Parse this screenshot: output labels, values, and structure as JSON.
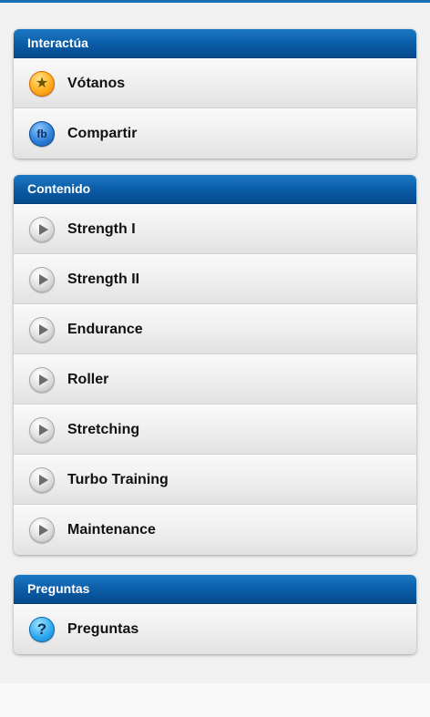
{
  "sections": [
    {
      "title": "Interactúa",
      "items": [
        {
          "label": "Vótanos",
          "icon": "star-icon"
        },
        {
          "label": "Compartir",
          "icon": "facebook-icon",
          "icon_text": "fb"
        }
      ]
    },
    {
      "title": "Contenido",
      "items": [
        {
          "label": "Strength I",
          "icon": "play-icon"
        },
        {
          "label": "Strength II",
          "icon": "play-icon"
        },
        {
          "label": "Endurance",
          "icon": "play-icon"
        },
        {
          "label": "Roller",
          "icon": "play-icon"
        },
        {
          "label": "Stretching",
          "icon": "play-icon"
        },
        {
          "label": "Turbo Training",
          "icon": "play-icon"
        },
        {
          "label": "Maintenance",
          "icon": "play-icon"
        }
      ]
    },
    {
      "title": "Preguntas",
      "items": [
        {
          "label": "Preguntas",
          "icon": "question-icon",
          "icon_text": "?"
        }
      ]
    }
  ],
  "colors": {
    "header_blue": "#0b5ba5",
    "background": "#f1f1f1",
    "text": "#111111"
  }
}
